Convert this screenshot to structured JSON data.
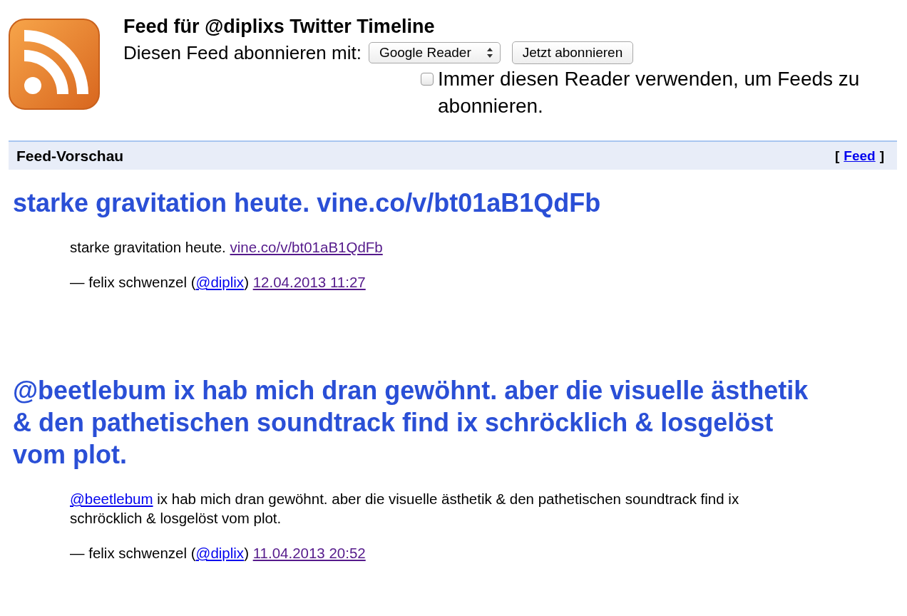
{
  "header": {
    "title": "Feed für @diplixs Twitter Timeline",
    "subscribe_label": "Diesen Feed abonnieren mit:",
    "reader_select": {
      "value": "Google Reader"
    },
    "subscribe_button": "Jetzt abonnieren",
    "always_use": {
      "label": "Immer diesen Reader verwenden, um Feeds zu abonnieren.",
      "checked": false
    }
  },
  "preview_bar": {
    "title": "Feed-Vorschau",
    "open_bracket": "[",
    "link": "Feed",
    "close_bracket": "]"
  },
  "entries": [
    {
      "title": "starke gravitation heute. vine.co/v/bt01aB1QdFb",
      "summary": [
        {
          "kind": "text",
          "text": "starke gravitation heute. "
        },
        {
          "kind": "link",
          "text": "vine.co/v/bt01aB1QdFb",
          "visited": true
        }
      ],
      "byline": {
        "prefix": "— felix schwenzel (",
        "handle": "@diplix",
        "suffix": ")",
        "date": "12.04.2013 11:27"
      }
    },
    {
      "title": "@beetlebum ix hab mich dran gewöhnt. aber die visuelle ästhetik & den pathetischen soundtrack find ix schröcklich & losgelöst vom plot.",
      "summary": [
        {
          "kind": "link",
          "text": "@beetlebum",
          "visited": false
        },
        {
          "kind": "text",
          "text": " ix hab mich dran gewöhnt. aber die visuelle ästhetik & den pathetischen soundtrack find ix schröcklich & losgelöst vom plot."
        }
      ],
      "byline": {
        "prefix": "— felix schwenzel (",
        "handle": "@diplix",
        "suffix": ")",
        "date": "11.04.2013 20:52"
      }
    }
  ]
}
